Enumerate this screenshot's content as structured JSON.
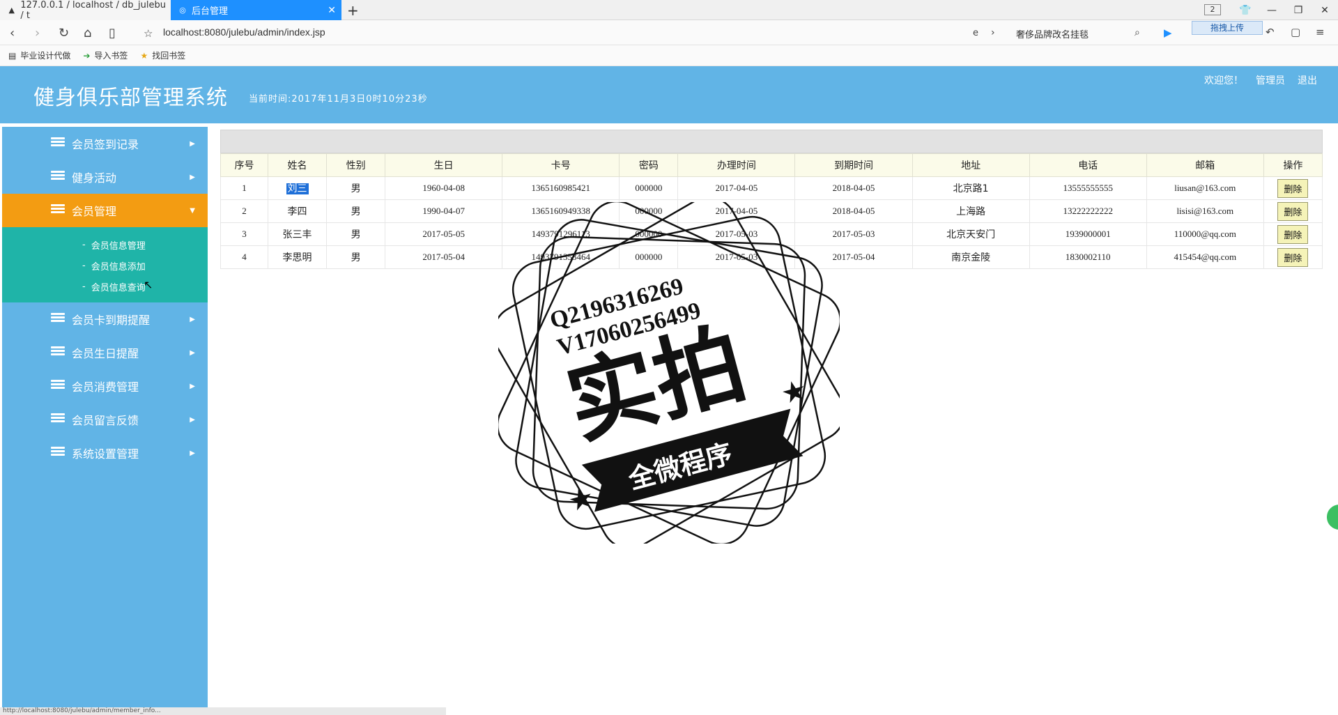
{
  "browser": {
    "tabs": [
      {
        "label": "127.0.0.1 / localhost / db_julebu / t"
      },
      {
        "label": "后台管理"
      }
    ],
    "tab_count_badge": "2",
    "url": "localhost:8080/julebu/admin/index.jsp",
    "search_text": "奢侈品牌改名挂毯",
    "upload_tip": "拖拽上传",
    "bookmarks": [
      {
        "label": "毕业设计代做"
      },
      {
        "label": "导入书签"
      },
      {
        "label": "找回书签"
      }
    ],
    "status_text": "http://localhost:8080/julebu/admin/member_info..."
  },
  "header": {
    "title": "健身俱乐部管理系统",
    "time_text": "当前时间:2017年11月3日0时10分23秒",
    "welcome": "欢迎您！",
    "user": "管理员",
    "logout": "退出"
  },
  "sidebar": {
    "items": [
      {
        "label": "会员签到记录"
      },
      {
        "label": "健身活动"
      },
      {
        "label": "会员管理"
      },
      {
        "label": "会员卡到期提醒"
      },
      {
        "label": "会员生日提醒"
      },
      {
        "label": "会员消费管理"
      },
      {
        "label": "会员留言反馈"
      },
      {
        "label": "系统设置管理"
      }
    ],
    "submenu": [
      {
        "label": "会员信息管理"
      },
      {
        "label": "会员信息添加"
      },
      {
        "label": "会员信息查询"
      }
    ]
  },
  "table": {
    "headers": [
      "序号",
      "姓名",
      "性别",
      "生日",
      "卡号",
      "密码",
      "办理时间",
      "到期时间",
      "地址",
      "电话",
      "邮箱",
      "操作"
    ],
    "rows": [
      {
        "no": "1",
        "name": "刘三",
        "sex": "男",
        "birthday": "1960-04-08",
        "card": "1365160985421",
        "password": "000000",
        "start": "2017-04-05",
        "end": "2018-04-05",
        "address": "北京路1",
        "phone": "13555555555",
        "email": "liusan@163.com",
        "action": "删除"
      },
      {
        "no": "2",
        "name": "李四",
        "sex": "男",
        "birthday": "1990-04-07",
        "card": "1365160949338",
        "password": "000000",
        "start": "2017-04-05",
        "end": "2018-04-05",
        "address": "上海路",
        "phone": "13222222222",
        "email": "lisisi@163.com",
        "action": "删除"
      },
      {
        "no": "3",
        "name": "张三丰",
        "sex": "男",
        "birthday": "2017-05-05",
        "card": "1493791296113",
        "password": "000000",
        "start": "2017-05-03",
        "end": "2017-05-03",
        "address": "北京天安门",
        "phone": "1939000001",
        "email": "110000@qq.com",
        "action": "删除"
      },
      {
        "no": "4",
        "name": "李思明",
        "sex": "男",
        "birthday": "2017-05-04",
        "card": "1493791353464",
        "password": "000000",
        "start": "2017-05-03",
        "end": "2017-05-04",
        "address": "南京金陵",
        "phone": "1830002110",
        "email": "415454@qq.com",
        "action": "删除"
      }
    ]
  },
  "stamp": {
    "line1": "Q2196316269",
    "line2": "V17060256499",
    "big": "实拍",
    "ribbon": "全微程序"
  },
  "colors": {
    "header_bg": "#61b4e6",
    "sidebar_bg": "#61b4e6",
    "active_menu": "#f39c12",
    "submenu_bg": "#1fb4a8",
    "tab_active": "#1e90ff"
  }
}
